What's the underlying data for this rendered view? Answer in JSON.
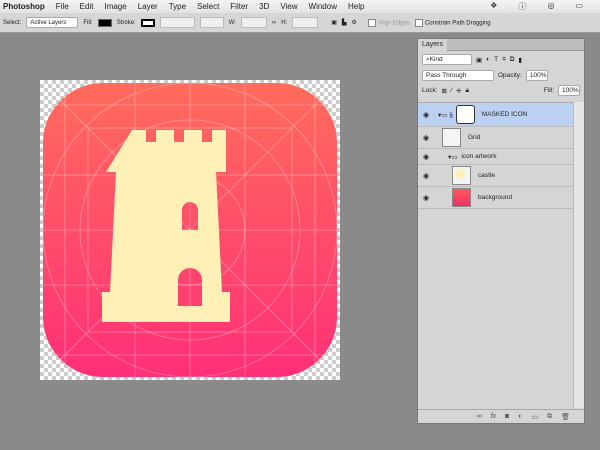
{
  "menu": {
    "app": "Photoshop",
    "items": [
      "File",
      "Edit",
      "Image",
      "Layer",
      "Type",
      "Select",
      "Filter",
      "3D",
      "View",
      "Window",
      "Help"
    ]
  },
  "options": {
    "select_label": "Select:",
    "select_value": "Active Layers",
    "fill_label": "Fill:",
    "stroke_label": "Stroke:",
    "w_label": "W:",
    "h_label": "H:",
    "align_edges": "Align Edges",
    "constrain": "Constrain Path Dragging"
  },
  "layers_panel": {
    "tab": "Layers",
    "filter": "Kind",
    "blend": "Pass Through",
    "opacity_label": "Opacity:",
    "opacity": "100%",
    "lock_label": "Lock:",
    "fill_label": "Fill:",
    "fill": "100%",
    "layers": [
      {
        "name": "MASKED ICON",
        "type": "group",
        "selected": true
      },
      {
        "name": "Grid",
        "type": "smart"
      },
      {
        "name": "icon artwork",
        "type": "group"
      },
      {
        "name": "castle",
        "type": "smart"
      },
      {
        "name": "background",
        "type": "smart"
      }
    ]
  },
  "colors": {
    "gradient_top": "#ff6c5c",
    "gradient_bottom": "#ff2f78",
    "castle": "#fff0b8",
    "selection": "#bcd0f2"
  }
}
